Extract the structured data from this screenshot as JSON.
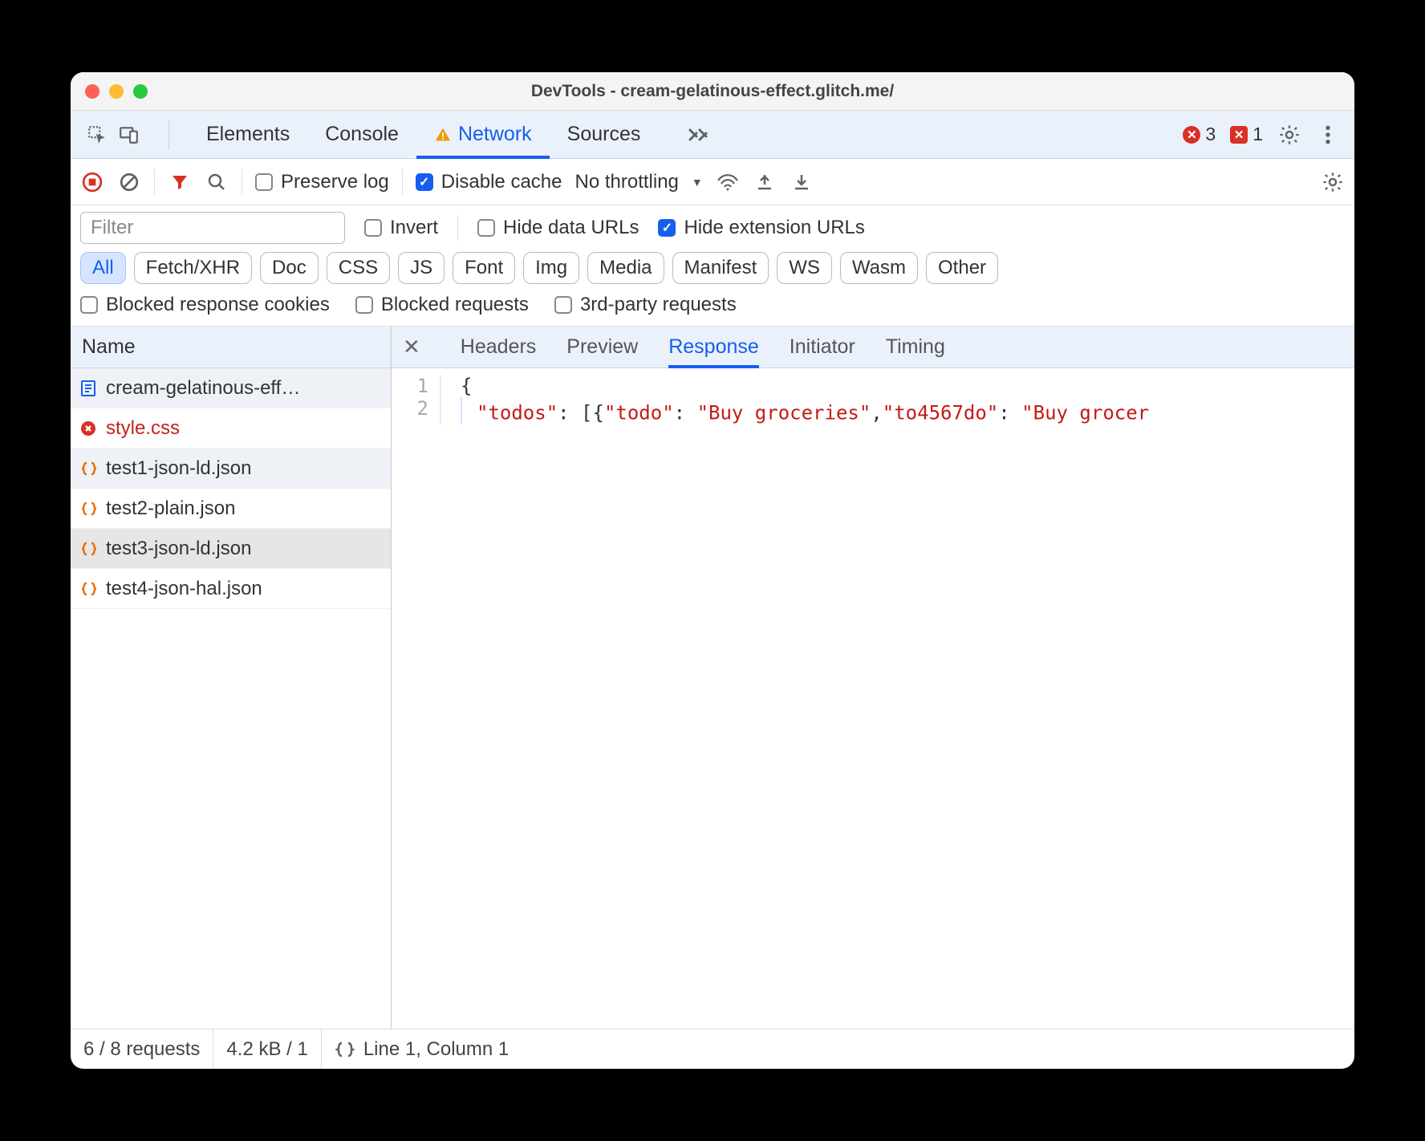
{
  "window": {
    "title": "DevTools - cream-gelatinous-effect.glitch.me/"
  },
  "topTabs": {
    "items": [
      "Elements",
      "Console",
      "Network",
      "Sources"
    ],
    "activeIndex": 2,
    "errors": {
      "count": "3"
    },
    "issues": {
      "count": "1"
    }
  },
  "toolbar": {
    "preserveLog": {
      "label": "Preserve log",
      "checked": false
    },
    "disableCache": {
      "label": "Disable cache",
      "checked": true
    },
    "throttling": {
      "label": "No throttling"
    }
  },
  "filter": {
    "placeholder": "Filter",
    "invert": {
      "label": "Invert",
      "checked": false
    },
    "hideDataUrls": {
      "label": "Hide data URLs",
      "checked": false
    },
    "hideExtUrls": {
      "label": "Hide extension URLs",
      "checked": true
    },
    "types": [
      "All",
      "Fetch/XHR",
      "Doc",
      "CSS",
      "JS",
      "Font",
      "Img",
      "Media",
      "Manifest",
      "WS",
      "Wasm",
      "Other"
    ],
    "activeType": "All",
    "blockedCookies": {
      "label": "Blocked response cookies",
      "checked": false
    },
    "blockedRequests": {
      "label": "Blocked requests",
      "checked": false
    },
    "thirdParty": {
      "label": "3rd-party requests",
      "checked": false
    }
  },
  "sidebar": {
    "header": "Name"
  },
  "requests": [
    {
      "name": "cream-gelatinous-eff…",
      "icon": "document",
      "state": "selected"
    },
    {
      "name": "style.css",
      "icon": "error",
      "state": "error"
    },
    {
      "name": "test1-json-ld.json",
      "icon": "json",
      "state": "selected"
    },
    {
      "name": "test2-plain.json",
      "icon": "json",
      "state": ""
    },
    {
      "name": "test3-json-ld.json",
      "icon": "json",
      "state": "hovered"
    },
    {
      "name": "test4-json-hal.json",
      "icon": "json",
      "state": ""
    }
  ],
  "detailTabs": {
    "items": [
      "Headers",
      "Preview",
      "Response",
      "Initiator",
      "Timing"
    ],
    "activeIndex": 2
  },
  "response": {
    "lines": [
      {
        "n": "1",
        "html": "<span class='tok-punc'>{</span>"
      },
      {
        "n": "2",
        "html": "<span class='indent-guide'></span><span class='tok-key'>\"todos\"</span><span class='tok-punc'>: [{</span><span class='tok-key'>\"todo\"</span><span class='tok-punc'>: </span><span class='tok-str'>\"Buy groceries\"</span><span class='tok-punc'>,</span><span class='tok-key'>\"to4567do\"</span><span class='tok-punc'>: </span><span class='tok-str'>\"Buy grocer</span>"
      }
    ]
  },
  "statusbar": {
    "requests": "6 / 8 requests",
    "transfer": "4.2 kB / 1",
    "cursor": "Line 1, Column 1"
  }
}
